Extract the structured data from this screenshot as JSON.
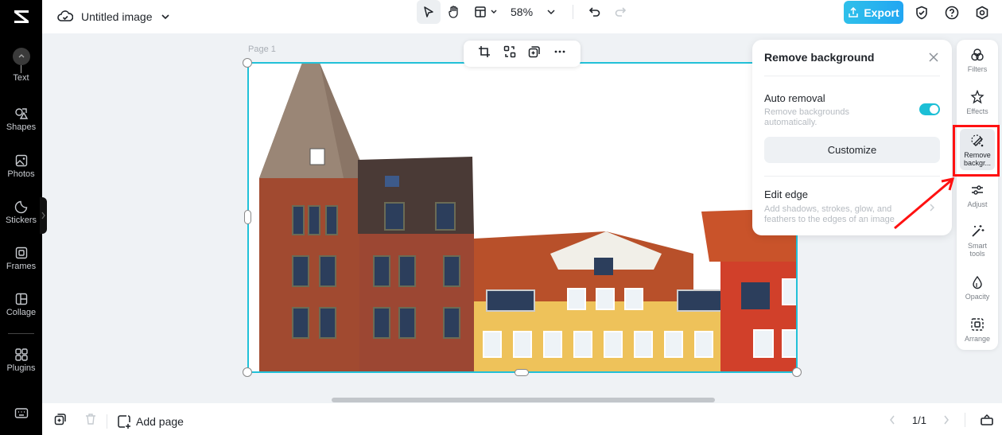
{
  "app": {
    "name": "CapCut"
  },
  "header": {
    "doc_title": "Untitled image",
    "zoom_level": "58%",
    "export_label": "Export",
    "export_color": "#21a6f2"
  },
  "sidebar": {
    "items": [
      {
        "label": "Text",
        "icon": "text-icon"
      },
      {
        "label": "Shapes",
        "icon": "shapes-icon"
      },
      {
        "label": "Photos",
        "icon": "photos-icon"
      },
      {
        "label": "Stickers",
        "icon": "stickers-icon"
      },
      {
        "label": "Frames",
        "icon": "frames-icon"
      },
      {
        "label": "Collage",
        "icon": "collage-icon"
      },
      {
        "label": "Plugins",
        "icon": "plugins-icon"
      }
    ]
  },
  "canvas": {
    "page_label": "Page 1",
    "selection_color": "#22c1d8",
    "image_description": "Colorful historic buildings (red brick, yellow and orange facades) with background removed"
  },
  "remove_bg_panel": {
    "title": "Remove background",
    "auto_removal": {
      "title": "Auto removal",
      "description": "Remove backgrounds automatically.",
      "enabled": true
    },
    "customize_label": "Customize",
    "edit_edge": {
      "title": "Edit edge",
      "description": "Add shadows, strokes, glow, and feathers to the edges of an image"
    },
    "toggle_color": "#1cbfd6"
  },
  "right_rail": {
    "items": [
      {
        "label": "Filters",
        "icon": "filters-icon"
      },
      {
        "label": "Effects",
        "icon": "effects-icon"
      },
      {
        "label": "Remove backgr...",
        "icon": "remove-background-icon",
        "active": true
      },
      {
        "label": "Adjust",
        "icon": "adjust-icon"
      },
      {
        "label": "Smart tools",
        "icon": "smart-tools-icon"
      },
      {
        "label": "Opacity",
        "icon": "opacity-icon"
      },
      {
        "label": "Arrange",
        "icon": "arrange-icon"
      }
    ],
    "highlight_color": "#ff1111"
  },
  "bottom": {
    "add_page_label": "Add page",
    "page_indicator": "1/1"
  }
}
